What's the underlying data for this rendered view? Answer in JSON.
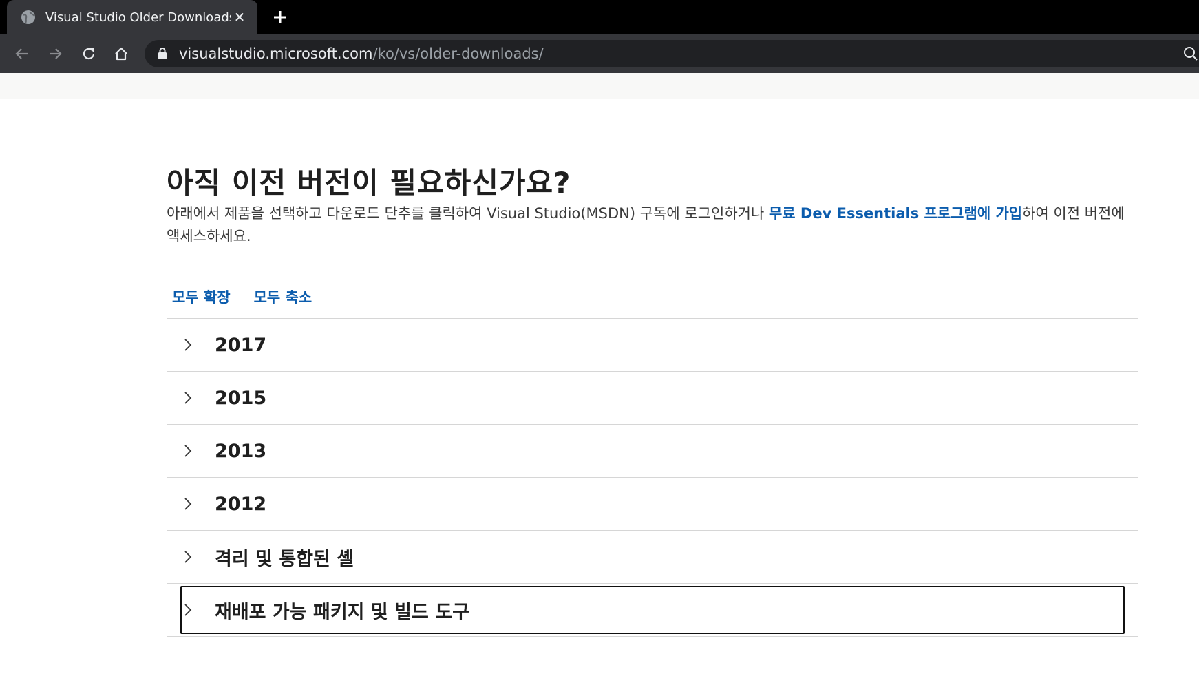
{
  "browser": {
    "tab_title": "Visual Studio Older Downloads",
    "tab_close": "✕",
    "url_host": "visualstudio.microsoft.com",
    "url_path": "/ko/vs/older-downloads/"
  },
  "page": {
    "title": "아직 이전 버전이 필요하신가요?",
    "intro_before": "아래에서 제품을 선택하고 다운로드 단추를 클릭하여 Visual Studio(MSDN) 구독에 로그인하거나 ",
    "intro_link": "무료 Dev Essentials 프로그램에 가입",
    "intro_after": "하여 이전 버전에 액세스하세요.",
    "expand_all": "모두 확장",
    "collapse_all": "모두 축소",
    "accordion": [
      {
        "label": "2017"
      },
      {
        "label": "2015"
      },
      {
        "label": "2013"
      },
      {
        "label": "2012"
      },
      {
        "label": "격리 및 통합된 셸"
      },
      {
        "label": "재배포 가능 패키지 및 빌드 도구"
      }
    ]
  },
  "colors": {
    "link": "#0b5cad",
    "tabstrip": "#000000",
    "toolbar": "#35363a"
  }
}
